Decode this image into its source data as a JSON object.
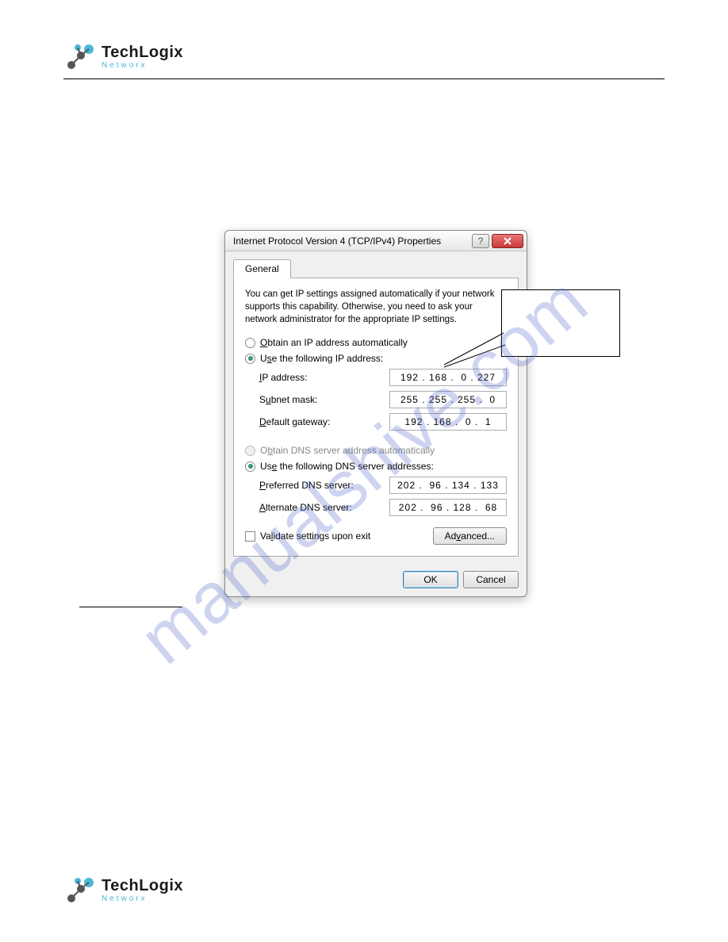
{
  "brand": {
    "main": "TechLogix",
    "sub": "Networx"
  },
  "watermark": "manualshive.com",
  "dialog": {
    "title": "Internet Protocol Version 4 (TCP/IPv4) Properties",
    "tab": "General",
    "help_text": "You can get IP settings assigned automatically if your network supports this capability. Otherwise, you need to ask your network administrator for the appropriate IP settings.",
    "radio_auto_ip": "Obtain an IP address automatically",
    "radio_manual_ip": "Use the following IP address:",
    "fields": {
      "ip_label": "IP address:",
      "ip_value": "192 . 168 .  0 . 227",
      "subnet_label": "Subnet mask:",
      "subnet_value": "255 . 255 . 255 .  0",
      "gateway_label": "Default gateway:",
      "gateway_value": "192 . 168 .  0 .  1"
    },
    "radio_auto_dns": "Obtain DNS server address automatically",
    "radio_manual_dns": "Use the following DNS server addresses:",
    "dns_fields": {
      "preferred_label": "Preferred DNS server:",
      "preferred_value": "202 .  96 . 134 . 133",
      "alternate_label": "Alternate DNS server:",
      "alternate_value": "202 .  96 . 128 .  68"
    },
    "validate_label": "Validate settings upon exit",
    "advanced_btn": "Advanced...",
    "ok_btn": "OK",
    "cancel_btn": "Cancel"
  }
}
